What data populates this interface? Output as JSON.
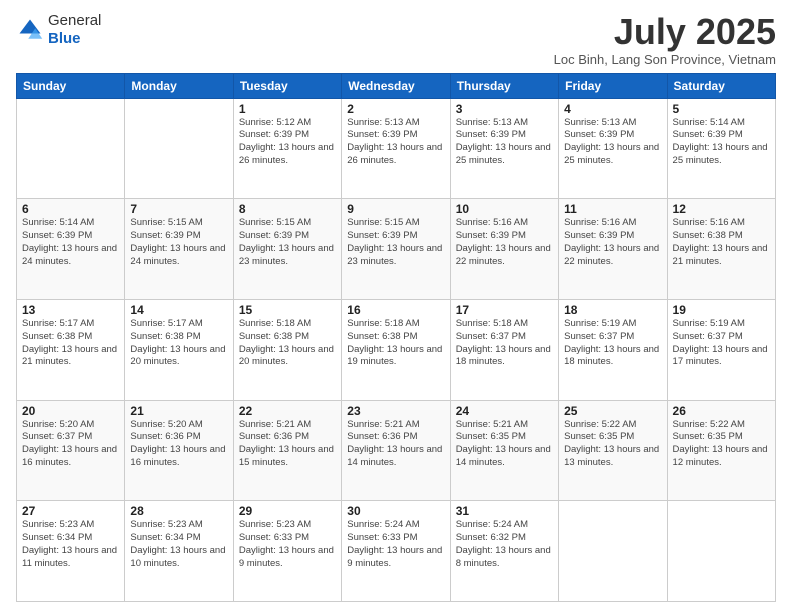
{
  "header": {
    "logo_line1": "General",
    "logo_line2": "Blue",
    "month_title": "July 2025",
    "location": "Loc Binh, Lang Son Province, Vietnam"
  },
  "weekdays": [
    "Sunday",
    "Monday",
    "Tuesday",
    "Wednesday",
    "Thursday",
    "Friday",
    "Saturday"
  ],
  "weeks": [
    [
      {
        "day": "",
        "info": ""
      },
      {
        "day": "",
        "info": ""
      },
      {
        "day": "1",
        "info": "Sunrise: 5:12 AM\nSunset: 6:39 PM\nDaylight: 13 hours and 26 minutes."
      },
      {
        "day": "2",
        "info": "Sunrise: 5:13 AM\nSunset: 6:39 PM\nDaylight: 13 hours and 26 minutes."
      },
      {
        "day": "3",
        "info": "Sunrise: 5:13 AM\nSunset: 6:39 PM\nDaylight: 13 hours and 25 minutes."
      },
      {
        "day": "4",
        "info": "Sunrise: 5:13 AM\nSunset: 6:39 PM\nDaylight: 13 hours and 25 minutes."
      },
      {
        "day": "5",
        "info": "Sunrise: 5:14 AM\nSunset: 6:39 PM\nDaylight: 13 hours and 25 minutes."
      }
    ],
    [
      {
        "day": "6",
        "info": "Sunrise: 5:14 AM\nSunset: 6:39 PM\nDaylight: 13 hours and 24 minutes."
      },
      {
        "day": "7",
        "info": "Sunrise: 5:15 AM\nSunset: 6:39 PM\nDaylight: 13 hours and 24 minutes."
      },
      {
        "day": "8",
        "info": "Sunrise: 5:15 AM\nSunset: 6:39 PM\nDaylight: 13 hours and 23 minutes."
      },
      {
        "day": "9",
        "info": "Sunrise: 5:15 AM\nSunset: 6:39 PM\nDaylight: 13 hours and 23 minutes."
      },
      {
        "day": "10",
        "info": "Sunrise: 5:16 AM\nSunset: 6:39 PM\nDaylight: 13 hours and 22 minutes."
      },
      {
        "day": "11",
        "info": "Sunrise: 5:16 AM\nSunset: 6:39 PM\nDaylight: 13 hours and 22 minutes."
      },
      {
        "day": "12",
        "info": "Sunrise: 5:16 AM\nSunset: 6:38 PM\nDaylight: 13 hours and 21 minutes."
      }
    ],
    [
      {
        "day": "13",
        "info": "Sunrise: 5:17 AM\nSunset: 6:38 PM\nDaylight: 13 hours and 21 minutes."
      },
      {
        "day": "14",
        "info": "Sunrise: 5:17 AM\nSunset: 6:38 PM\nDaylight: 13 hours and 20 minutes."
      },
      {
        "day": "15",
        "info": "Sunrise: 5:18 AM\nSunset: 6:38 PM\nDaylight: 13 hours and 20 minutes."
      },
      {
        "day": "16",
        "info": "Sunrise: 5:18 AM\nSunset: 6:38 PM\nDaylight: 13 hours and 19 minutes."
      },
      {
        "day": "17",
        "info": "Sunrise: 5:18 AM\nSunset: 6:37 PM\nDaylight: 13 hours and 18 minutes."
      },
      {
        "day": "18",
        "info": "Sunrise: 5:19 AM\nSunset: 6:37 PM\nDaylight: 13 hours and 18 minutes."
      },
      {
        "day": "19",
        "info": "Sunrise: 5:19 AM\nSunset: 6:37 PM\nDaylight: 13 hours and 17 minutes."
      }
    ],
    [
      {
        "day": "20",
        "info": "Sunrise: 5:20 AM\nSunset: 6:37 PM\nDaylight: 13 hours and 16 minutes."
      },
      {
        "day": "21",
        "info": "Sunrise: 5:20 AM\nSunset: 6:36 PM\nDaylight: 13 hours and 16 minutes."
      },
      {
        "day": "22",
        "info": "Sunrise: 5:21 AM\nSunset: 6:36 PM\nDaylight: 13 hours and 15 minutes."
      },
      {
        "day": "23",
        "info": "Sunrise: 5:21 AM\nSunset: 6:36 PM\nDaylight: 13 hours and 14 minutes."
      },
      {
        "day": "24",
        "info": "Sunrise: 5:21 AM\nSunset: 6:35 PM\nDaylight: 13 hours and 14 minutes."
      },
      {
        "day": "25",
        "info": "Sunrise: 5:22 AM\nSunset: 6:35 PM\nDaylight: 13 hours and 13 minutes."
      },
      {
        "day": "26",
        "info": "Sunrise: 5:22 AM\nSunset: 6:35 PM\nDaylight: 13 hours and 12 minutes."
      }
    ],
    [
      {
        "day": "27",
        "info": "Sunrise: 5:23 AM\nSunset: 6:34 PM\nDaylight: 13 hours and 11 minutes."
      },
      {
        "day": "28",
        "info": "Sunrise: 5:23 AM\nSunset: 6:34 PM\nDaylight: 13 hours and 10 minutes."
      },
      {
        "day": "29",
        "info": "Sunrise: 5:23 AM\nSunset: 6:33 PM\nDaylight: 13 hours and 9 minutes."
      },
      {
        "day": "30",
        "info": "Sunrise: 5:24 AM\nSunset: 6:33 PM\nDaylight: 13 hours and 9 minutes."
      },
      {
        "day": "31",
        "info": "Sunrise: 5:24 AM\nSunset: 6:32 PM\nDaylight: 13 hours and 8 minutes."
      },
      {
        "day": "",
        "info": ""
      },
      {
        "day": "",
        "info": ""
      }
    ]
  ]
}
